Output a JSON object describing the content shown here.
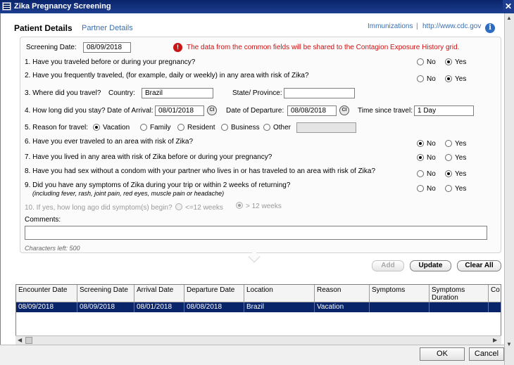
{
  "window": {
    "title": "Zika Pregnancy Screening"
  },
  "tabs": [
    {
      "label": "Patient Details",
      "active": true
    },
    {
      "label": "Partner Details",
      "active": false
    }
  ],
  "top_links": {
    "immunizations": "Immunizations",
    "separator": "|",
    "cdc": "http://www.cdc.gov"
  },
  "screening_date": {
    "label": "Screening Date:",
    "value": "08/09/2018"
  },
  "alert": "The data from the common fields will be shared to the Contagion Exposure History grid.",
  "radio_labels": {
    "no": "No",
    "yes": "Yes"
  },
  "questions": {
    "q1": {
      "text": "1. Have you traveled before or during your pregnancy?",
      "answer": "Yes"
    },
    "q2": {
      "text": "2. Have you frequently traveled, (for example, daily or weekly) in any area with risk of Zika?",
      "answer": "Yes"
    },
    "q3": {
      "text": "3. Where did you travel?",
      "country_label": "Country:",
      "country": "Brazil",
      "state_label": "State/ Province:",
      "state": ""
    },
    "q4": {
      "text": "4. How long did you stay?",
      "arrival_label": "Date of Arrival:",
      "arrival": "08/01/2018",
      "departure_label": "Date of Departure:",
      "departure": "08/08/2018",
      "since_label": "Time since travel:",
      "since": "1 Day",
      "cal_icon": "CI"
    },
    "q5": {
      "text": "5. Reason for travel:",
      "options": [
        "Vacation",
        "Family",
        "Resident",
        "Business",
        "Other"
      ],
      "selected": "Vacation"
    },
    "q6": {
      "text": "6. Have you ever traveled to an area with risk of Zika?",
      "answer": "No"
    },
    "q7": {
      "text": "7. Have you lived in any area with risk of Zika before or during your pregnancy?",
      "answer": "No"
    },
    "q8": {
      "text": "8. Have you had sex without a condom with your partner who lives in or has traveled to an area with risk of Zika?",
      "answer": "Yes"
    },
    "q9": {
      "text": "9. Did you have any symptoms of Zika during your trip or within 2 weeks of returning?",
      "subtext": "(including fever, rash, joint pain, red eyes, muscle pain or headache)",
      "answer": ""
    },
    "q10": {
      "text": "10. If yes, how long ago did symptom(s) begin?",
      "options": [
        "<=12 weeks",
        "> 12 weeks"
      ],
      "selected": "> 12 weeks"
    }
  },
  "comments": {
    "label": "Comments:",
    "value": "",
    "chars_left": "Characters left: 500"
  },
  "actions": {
    "add": "Add",
    "update": "Update",
    "clear_all": "Clear All"
  },
  "grid": {
    "columns": [
      "Encounter Date",
      "Screening Date",
      "Arrival Date",
      "Departure Date",
      "Location",
      "Reason",
      "Symptoms",
      "Symptoms Duration",
      "Co"
    ],
    "rows": [
      [
        "08/09/2018",
        "08/09/2018",
        "08/01/2018",
        "08/08/2018",
        "Brazil",
        "Vacation",
        "",
        "",
        ""
      ]
    ]
  },
  "dialog": {
    "ok": "OK",
    "cancel": "Cancel"
  },
  "colors": {
    "title_bar": "#0a246a",
    "link": "#3a6fb0",
    "alert": "#d01010",
    "selected_row": "#0a246a"
  }
}
